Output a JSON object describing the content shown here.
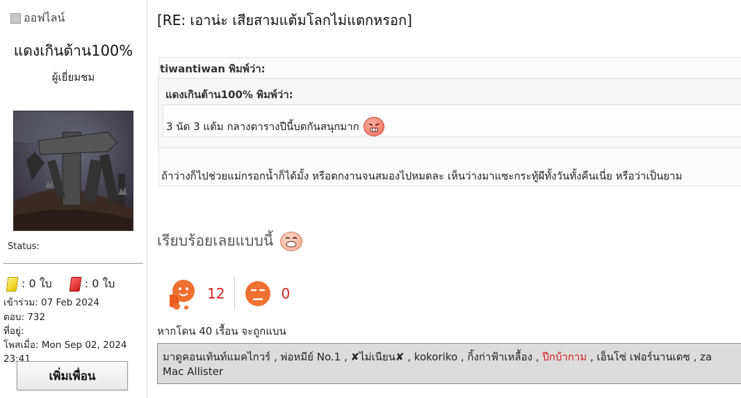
{
  "sidebar": {
    "online_status": "ออฟไลน์",
    "username": "แดงเกินต้าน100%",
    "rank": "ผู้เยี่ยมชม",
    "status_label": "Status:",
    "yellow_cards": ": 0 ใบ",
    "red_cards": ": 0 ใบ",
    "joined": "เข้าร่วม: 07 Feb 2024",
    "replies": "ตอบ: 732",
    "location": "ที่อยู่:",
    "posted": "โพสเมื่อ: Mon Sep 02, 2024 23:41",
    "add_friend": "เพิ่มเพื่อน"
  },
  "post": {
    "title": "[RE: เอาน่ะ เสียสามแต้มโลกไม่แตกหรอก]",
    "outer_quote": {
      "author": "tiwantiwan พิมพ์ว่า:",
      "text": "ถ้าว่างก็ไปช่วยแม่กรอกน้ำก็ได้มั้ง หรือตกงานจนสมองไปหมดละ เห็นว่างมาแซะกระทู้ผีทั้งวันทั้งคืนเนี่ย หรือว่าเป็นยาม"
    },
    "inner_quote": {
      "author": "แดงเกินต้าน100% พิมพ์ว่า:",
      "text": "3 นัด 3 แต้ม กลางตารางปีนี้บดกันสนุกมาก",
      "emoticon": "angry-face-icon"
    },
    "reply": "เรียบร้อยเลยแบบนี้",
    "reply_emoticon": "laughing-face-icon"
  },
  "reactions": {
    "like_count": "12",
    "dislike_count": "0"
  },
  "ban_note": "หากโดน 40 เรื้อน จะถูกแบน",
  "likers": {
    "part1": "มาดูคอนเท้นท์แมคไกวร์ , พ่อหมีย์ No.1 , ",
    "x_mark": "✘",
    "x_name": "ไม่เนียน",
    "part2": " , kokoriko , กิ้งก่าฟ้าเหลื้อง , ",
    "red_name": "ปีกบ้ากาม",
    "part3": " , เอ็นโซ่ เฟอร์นานเดซ , za",
    "line2": "Mac Allister"
  },
  "colors": {
    "accent_red": "#d42020",
    "likers_bg": "#dcdcdc"
  }
}
